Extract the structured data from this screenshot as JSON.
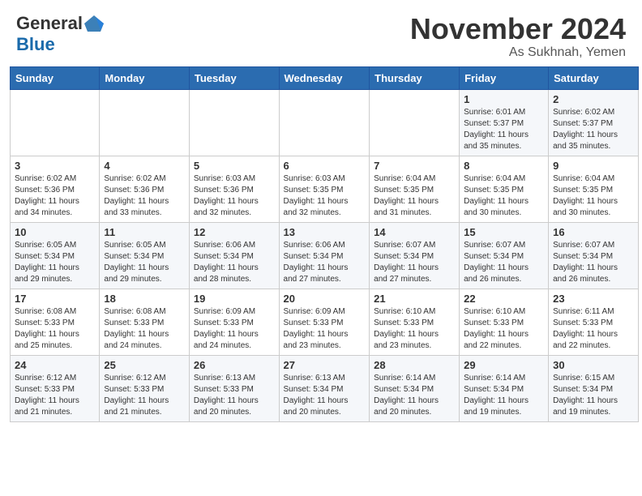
{
  "header": {
    "logo_general": "General",
    "logo_blue": "Blue",
    "month_title": "November 2024",
    "location": "As Sukhnah, Yemen"
  },
  "days_of_week": [
    "Sunday",
    "Monday",
    "Tuesday",
    "Wednesday",
    "Thursday",
    "Friday",
    "Saturday"
  ],
  "weeks": [
    [
      {
        "day": "",
        "info": ""
      },
      {
        "day": "",
        "info": ""
      },
      {
        "day": "",
        "info": ""
      },
      {
        "day": "",
        "info": ""
      },
      {
        "day": "",
        "info": ""
      },
      {
        "day": "1",
        "info": "Sunrise: 6:01 AM\nSunset: 5:37 PM\nDaylight: 11 hours and 35 minutes."
      },
      {
        "day": "2",
        "info": "Sunrise: 6:02 AM\nSunset: 5:37 PM\nDaylight: 11 hours and 35 minutes."
      }
    ],
    [
      {
        "day": "3",
        "info": "Sunrise: 6:02 AM\nSunset: 5:36 PM\nDaylight: 11 hours and 34 minutes."
      },
      {
        "day": "4",
        "info": "Sunrise: 6:02 AM\nSunset: 5:36 PM\nDaylight: 11 hours and 33 minutes."
      },
      {
        "day": "5",
        "info": "Sunrise: 6:03 AM\nSunset: 5:36 PM\nDaylight: 11 hours and 32 minutes."
      },
      {
        "day": "6",
        "info": "Sunrise: 6:03 AM\nSunset: 5:35 PM\nDaylight: 11 hours and 32 minutes."
      },
      {
        "day": "7",
        "info": "Sunrise: 6:04 AM\nSunset: 5:35 PM\nDaylight: 11 hours and 31 minutes."
      },
      {
        "day": "8",
        "info": "Sunrise: 6:04 AM\nSunset: 5:35 PM\nDaylight: 11 hours and 30 minutes."
      },
      {
        "day": "9",
        "info": "Sunrise: 6:04 AM\nSunset: 5:35 PM\nDaylight: 11 hours and 30 minutes."
      }
    ],
    [
      {
        "day": "10",
        "info": "Sunrise: 6:05 AM\nSunset: 5:34 PM\nDaylight: 11 hours and 29 minutes."
      },
      {
        "day": "11",
        "info": "Sunrise: 6:05 AM\nSunset: 5:34 PM\nDaylight: 11 hours and 29 minutes."
      },
      {
        "day": "12",
        "info": "Sunrise: 6:06 AM\nSunset: 5:34 PM\nDaylight: 11 hours and 28 minutes."
      },
      {
        "day": "13",
        "info": "Sunrise: 6:06 AM\nSunset: 5:34 PM\nDaylight: 11 hours and 27 minutes."
      },
      {
        "day": "14",
        "info": "Sunrise: 6:07 AM\nSunset: 5:34 PM\nDaylight: 11 hours and 27 minutes."
      },
      {
        "day": "15",
        "info": "Sunrise: 6:07 AM\nSunset: 5:34 PM\nDaylight: 11 hours and 26 minutes."
      },
      {
        "day": "16",
        "info": "Sunrise: 6:07 AM\nSunset: 5:34 PM\nDaylight: 11 hours and 26 minutes."
      }
    ],
    [
      {
        "day": "17",
        "info": "Sunrise: 6:08 AM\nSunset: 5:33 PM\nDaylight: 11 hours and 25 minutes."
      },
      {
        "day": "18",
        "info": "Sunrise: 6:08 AM\nSunset: 5:33 PM\nDaylight: 11 hours and 24 minutes."
      },
      {
        "day": "19",
        "info": "Sunrise: 6:09 AM\nSunset: 5:33 PM\nDaylight: 11 hours and 24 minutes."
      },
      {
        "day": "20",
        "info": "Sunrise: 6:09 AM\nSunset: 5:33 PM\nDaylight: 11 hours and 23 minutes."
      },
      {
        "day": "21",
        "info": "Sunrise: 6:10 AM\nSunset: 5:33 PM\nDaylight: 11 hours and 23 minutes."
      },
      {
        "day": "22",
        "info": "Sunrise: 6:10 AM\nSunset: 5:33 PM\nDaylight: 11 hours and 22 minutes."
      },
      {
        "day": "23",
        "info": "Sunrise: 6:11 AM\nSunset: 5:33 PM\nDaylight: 11 hours and 22 minutes."
      }
    ],
    [
      {
        "day": "24",
        "info": "Sunrise: 6:12 AM\nSunset: 5:33 PM\nDaylight: 11 hours and 21 minutes."
      },
      {
        "day": "25",
        "info": "Sunrise: 6:12 AM\nSunset: 5:33 PM\nDaylight: 11 hours and 21 minutes."
      },
      {
        "day": "26",
        "info": "Sunrise: 6:13 AM\nSunset: 5:33 PM\nDaylight: 11 hours and 20 minutes."
      },
      {
        "day": "27",
        "info": "Sunrise: 6:13 AM\nSunset: 5:34 PM\nDaylight: 11 hours and 20 minutes."
      },
      {
        "day": "28",
        "info": "Sunrise: 6:14 AM\nSunset: 5:34 PM\nDaylight: 11 hours and 20 minutes."
      },
      {
        "day": "29",
        "info": "Sunrise: 6:14 AM\nSunset: 5:34 PM\nDaylight: 11 hours and 19 minutes."
      },
      {
        "day": "30",
        "info": "Sunrise: 6:15 AM\nSunset: 5:34 PM\nDaylight: 11 hours and 19 minutes."
      }
    ]
  ]
}
